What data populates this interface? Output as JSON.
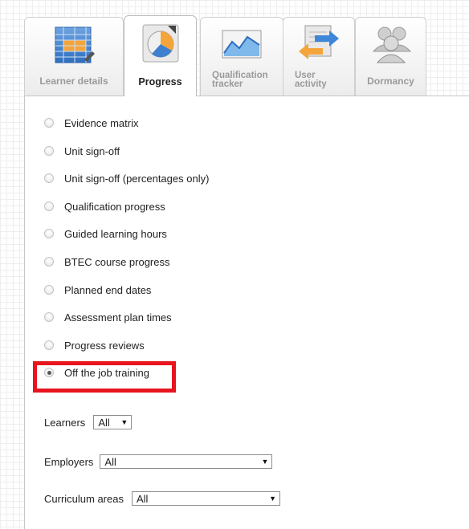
{
  "tabs": [
    {
      "label": "Learner details",
      "icon": "learner-details-icon",
      "active": false
    },
    {
      "label": "Progress",
      "icon": "progress-pie-chart-icon",
      "active": true
    },
    {
      "label_line1": "Qualification",
      "label_line2": "tracker",
      "icon": "qualification-tracker-chart-icon",
      "active": false
    },
    {
      "label_line1": "User",
      "label_line2": "activity",
      "icon": "user-activity-icon",
      "active": false
    },
    {
      "label": "Dormancy",
      "icon": "dormancy-users-icon",
      "active": false
    }
  ],
  "report_options": [
    {
      "label": "Evidence matrix",
      "checked": false
    },
    {
      "label": "Unit sign-off",
      "checked": false
    },
    {
      "label": "Unit sign-off (percentages only)",
      "checked": false
    },
    {
      "label": "Qualification progress",
      "checked": false
    },
    {
      "label": "Guided learning hours",
      "checked": false
    },
    {
      "label": "BTEC course progress",
      "checked": false
    },
    {
      "label": "Planned end dates",
      "checked": false
    },
    {
      "label": "Assessment plan times",
      "checked": false
    },
    {
      "label": "Progress reviews",
      "checked": false
    },
    {
      "label": "Off the job training",
      "checked": true
    }
  ],
  "filters": {
    "learners": {
      "label": "Learners",
      "value": "All"
    },
    "employers": {
      "label": "Employers",
      "value": "All"
    },
    "curriculum_areas": {
      "label": "Curriculum areas",
      "value": "All"
    }
  },
  "colors": {
    "highlight": "#e8141e"
  }
}
